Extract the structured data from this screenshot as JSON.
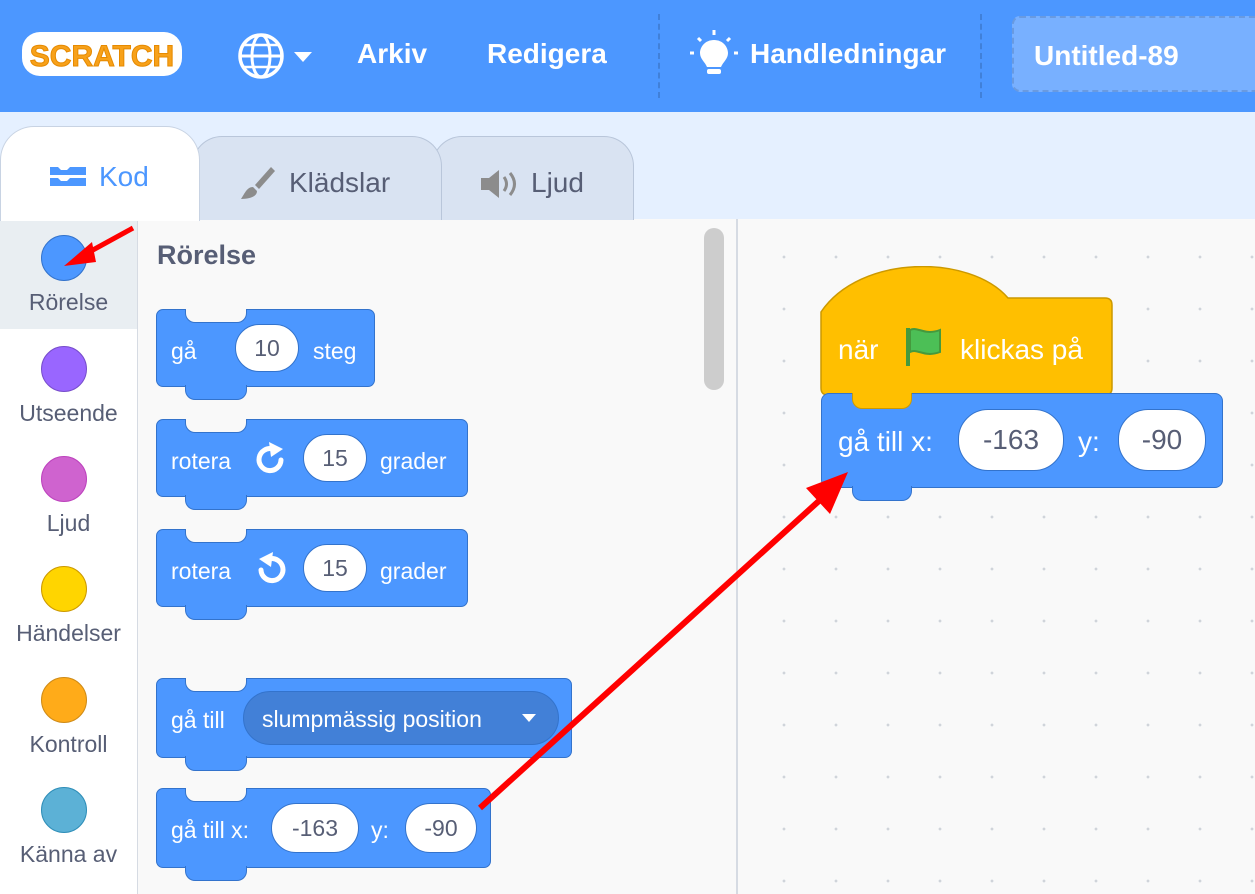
{
  "menubar": {
    "logo_text": "SCRATCH",
    "file_label": "Arkiv",
    "edit_label": "Redigera",
    "tutorials_label": "Handledningar",
    "project_title": "Untitled-89"
  },
  "tabs": {
    "code": "Kod",
    "costumes": "Klädslar",
    "sounds": "Ljud"
  },
  "categories": [
    {
      "label": "Rörelse",
      "color": "#4c97ff"
    },
    {
      "label": "Utseende",
      "color": "#9966ff"
    },
    {
      "label": "Ljud",
      "color": "#cf63cf"
    },
    {
      "label": "Händelser",
      "color": "#ffd500"
    },
    {
      "label": "Kontroll",
      "color": "#ffab19"
    },
    {
      "label": "Känna av",
      "color": "#5cb1d6"
    }
  ],
  "palette": {
    "heading": "Rörelse",
    "move": {
      "text": "gå",
      "value": "10",
      "unit": "steg"
    },
    "turn_right": {
      "text": "rotera",
      "value": "15",
      "unit": "grader"
    },
    "turn_left": {
      "text": "rotera",
      "value": "15",
      "unit": "grader"
    },
    "goto": {
      "text": "gå till",
      "dropdown": "slumpmässig position"
    },
    "gotoxy": {
      "text": "gå till x:",
      "x": "-163",
      "y_label": "y:",
      "y": "-90"
    }
  },
  "workspace": {
    "hat": {
      "text_before": "när",
      "text_after": "klickas på"
    },
    "gotoxy": {
      "text": "gå till x:",
      "x": "-163",
      "y_label": "y:",
      "y": "-90"
    }
  },
  "colors": {
    "menubar": "#4c97ff",
    "motion": "#4c97ff",
    "events": "#ffbf00",
    "annotation_arrow": "#ff0000"
  }
}
